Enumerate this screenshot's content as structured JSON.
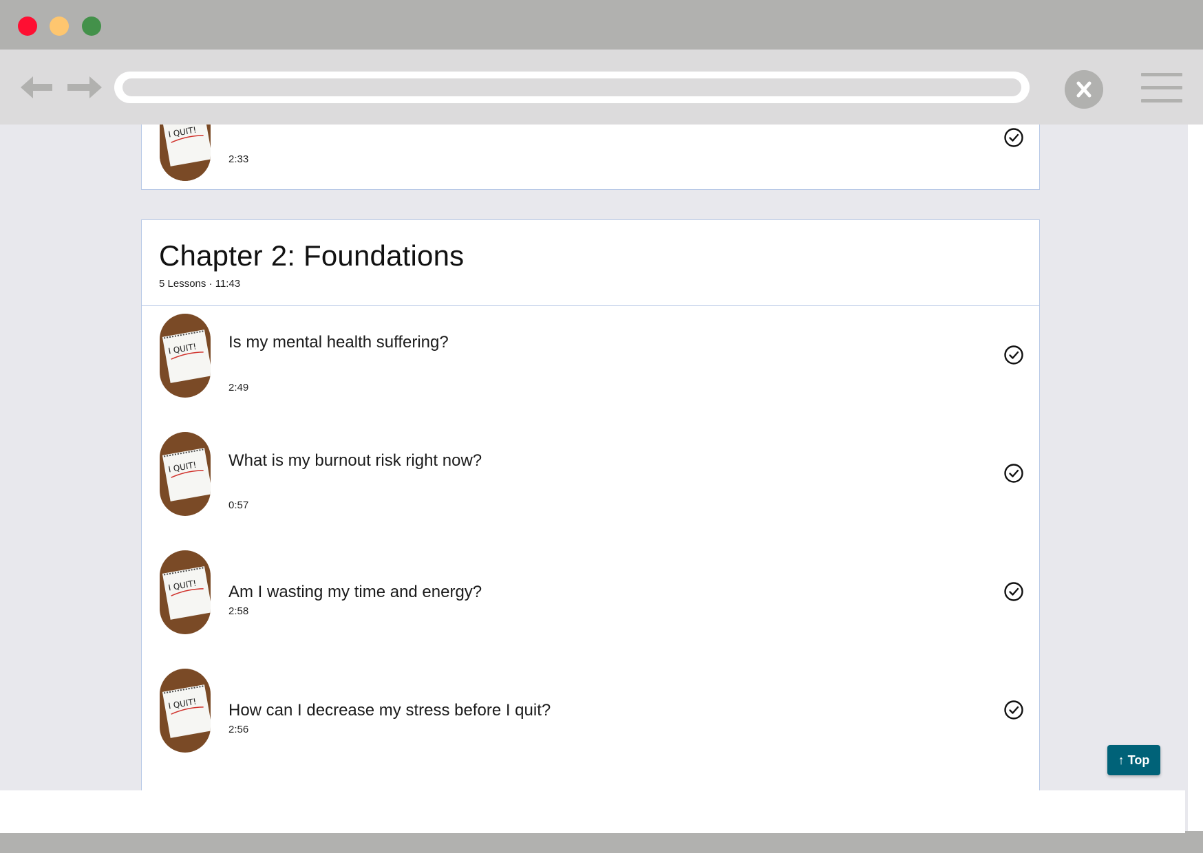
{
  "chapter": {
    "title": "Chapter 2: Foundations",
    "meta": "5 Lessons · 11:43"
  },
  "previous_lesson": {
    "duration": "2:33"
  },
  "lessons": [
    {
      "title": "Is my mental health suffering?",
      "duration": "2:49"
    },
    {
      "title": "What is my burnout risk right now?",
      "duration": "0:57"
    },
    {
      "title": "Am I wasting my time and energy?",
      "duration": "2:58"
    },
    {
      "title": "How can I decrease my stress before I quit?",
      "duration": "2:56"
    }
  ],
  "thumbnail_text": "I QUIT!",
  "back_to_top": "↑ Top",
  "colors": {
    "accent": "#006278",
    "card_border": "#b8c9e6",
    "page_bg": "#e8e8ed",
    "chrome": "#b1b1af"
  }
}
